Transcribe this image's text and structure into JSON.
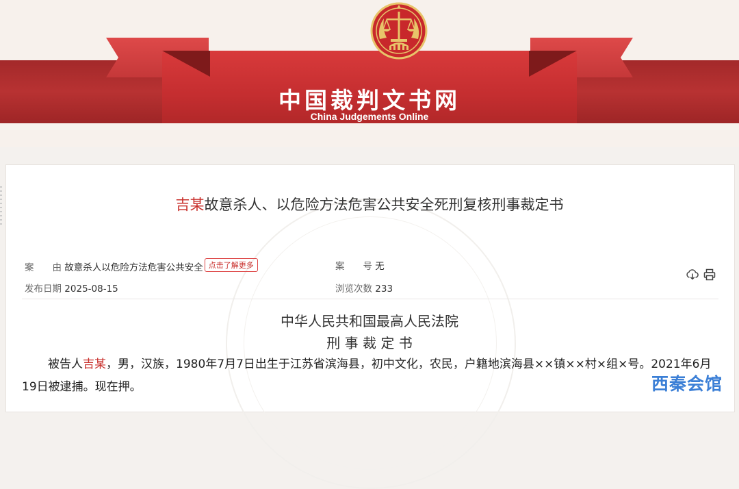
{
  "header": {
    "site_name_cn": "中国裁判文书网",
    "site_name_en": "China Judgements Online",
    "colors": {
      "brand_red": "#c52e30",
      "gold": "#e8c46a"
    },
    "emblem_icon": "court-emblem-icon"
  },
  "document": {
    "title_name": "吉某",
    "title_rest": "故意杀人、以危险方法危害公共安全死刑复核刑事裁定书",
    "meta": {
      "cause_label": "案　　由",
      "cause_value": "故意杀人以危险方法危害公共安全",
      "more_button": "点击了解更多",
      "case_no_label": "案　　号",
      "case_no_value": "无",
      "publish_date_label": "发布日期",
      "publish_date_value": "2025-08-15",
      "views_label": "浏览次数",
      "views_value": "233"
    },
    "toolbar": {
      "download_icon": "download-icon",
      "print_icon": "print-icon"
    },
    "court_name": "中华人民共和国最高人民法院",
    "doc_type": "刑 事 裁 定 书",
    "para1_prefix": "被告人",
    "para1_name": "吉某",
    "para1_text": "，男，汉族，1980年7月7日出生于江苏省滨海县，初中文化，农民，户籍地滨海县××镇××村×组×号。2021年6月19日被逮捕。现在押。"
  },
  "watermark_logo": "西秦会馆"
}
